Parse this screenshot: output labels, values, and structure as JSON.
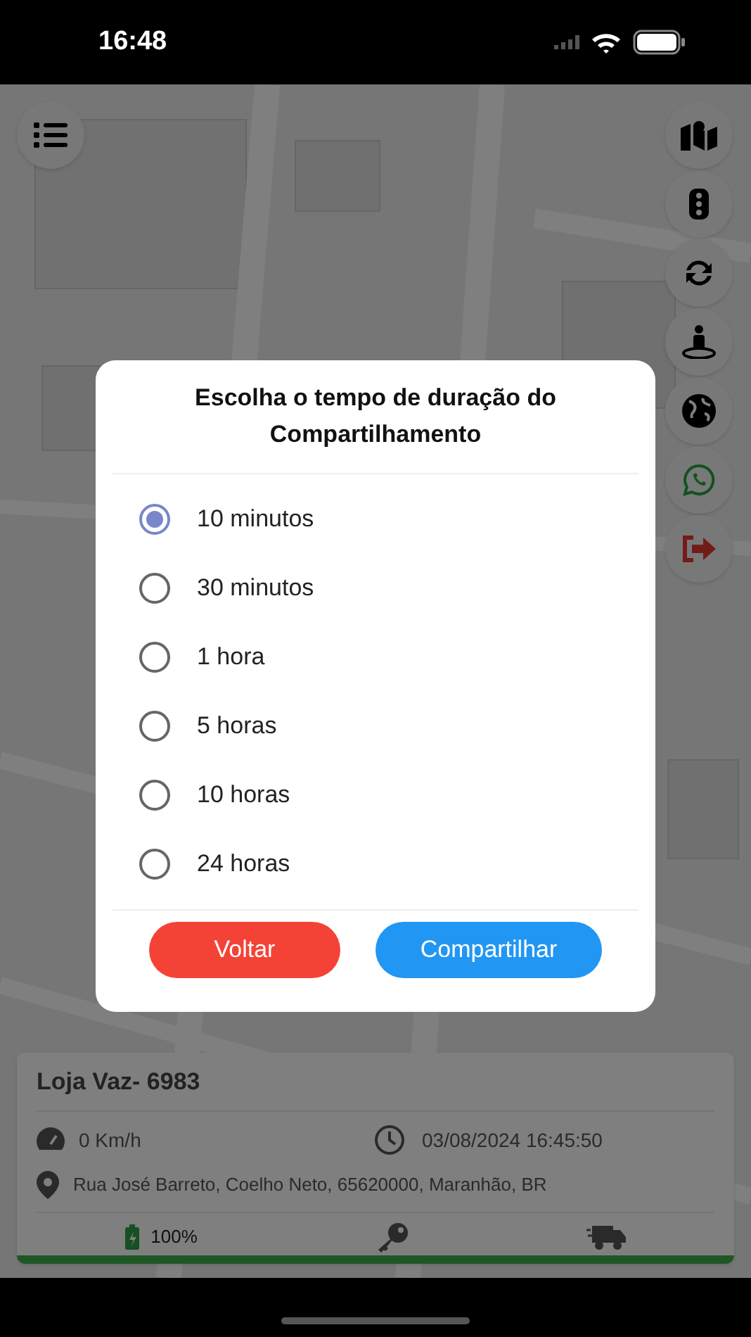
{
  "status_bar": {
    "time": "16:48"
  },
  "vehicle_card": {
    "name": "Loja Vaz- 6983",
    "speed": "0 Km/h",
    "datetime": "03/08/2024 16:45:50",
    "address": "Rua José Barreto, Coelho Neto, 65620000, Maranhão, BR",
    "battery": "100%"
  },
  "dialog": {
    "title": "Escolha o tempo de duração do Compartilhamento",
    "options": [
      {
        "label": "10 minutos",
        "selected": true
      },
      {
        "label": "30 minutos",
        "selected": false
      },
      {
        "label": "1 hora",
        "selected": false
      },
      {
        "label": "5 horas",
        "selected": false
      },
      {
        "label": "10 horas",
        "selected": false
      },
      {
        "label": "24 horas",
        "selected": false
      }
    ],
    "buttons": [
      {
        "label": "Voltar",
        "kind": "cancel"
      },
      {
        "label": "Compartilhar",
        "kind": "confirm"
      }
    ]
  }
}
